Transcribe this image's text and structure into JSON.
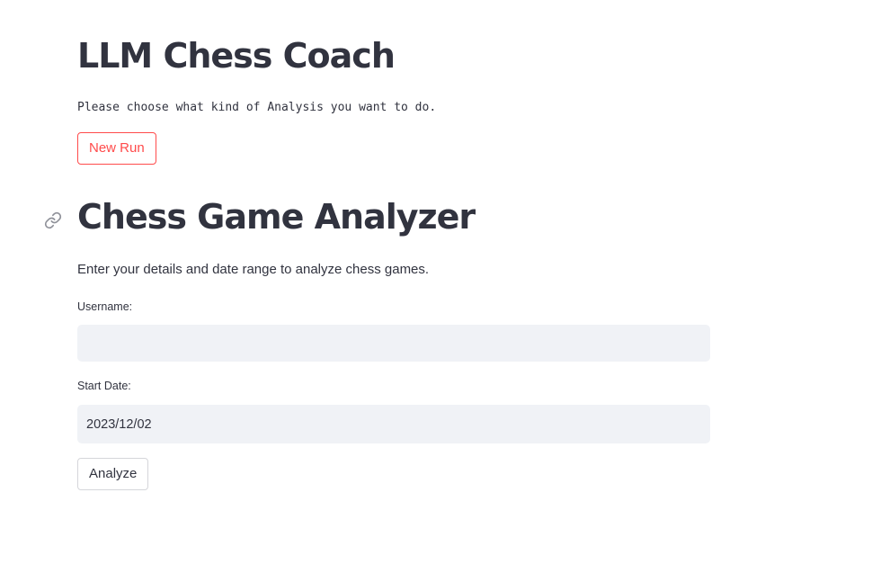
{
  "header": {
    "title": "LLM Chess Coach",
    "intro": "Please choose what kind of Analysis you want to do.",
    "new_run_label": "New Run"
  },
  "analyzer": {
    "title": "Chess Game Analyzer",
    "description": "Enter your details and date range to analyze chess games.",
    "username_label": "Username:",
    "username_value": "",
    "start_date_label": "Start Date:",
    "start_date_value": "2023/12/02",
    "analyze_label": "Analyze"
  },
  "icons": {
    "anchor": "link-icon"
  },
  "colors": {
    "accent": "#ff4b4b",
    "text": "#31333f",
    "input_bg": "#f0f2f6",
    "button_border": "#d5d6da",
    "icon_gray": "#8f9199"
  }
}
